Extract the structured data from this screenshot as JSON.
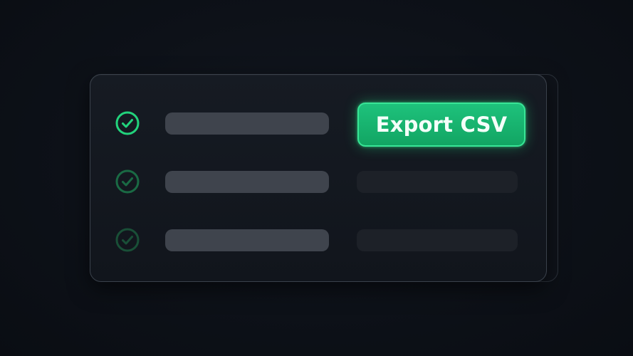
{
  "export_button": {
    "label": "Export CSV"
  },
  "colors": {
    "accent": "#18b36e",
    "accent_border": "#38e596",
    "check_active": "#22d37c",
    "check_inactive": "#1a6a44",
    "background": "#0d1118"
  },
  "rows": [
    {
      "status": "checked",
      "icon": "check-circle-icon",
      "active": true
    },
    {
      "status": "checked",
      "icon": "check-circle-icon",
      "active": false
    },
    {
      "status": "checked",
      "icon": "check-circle-icon",
      "active": false
    }
  ]
}
